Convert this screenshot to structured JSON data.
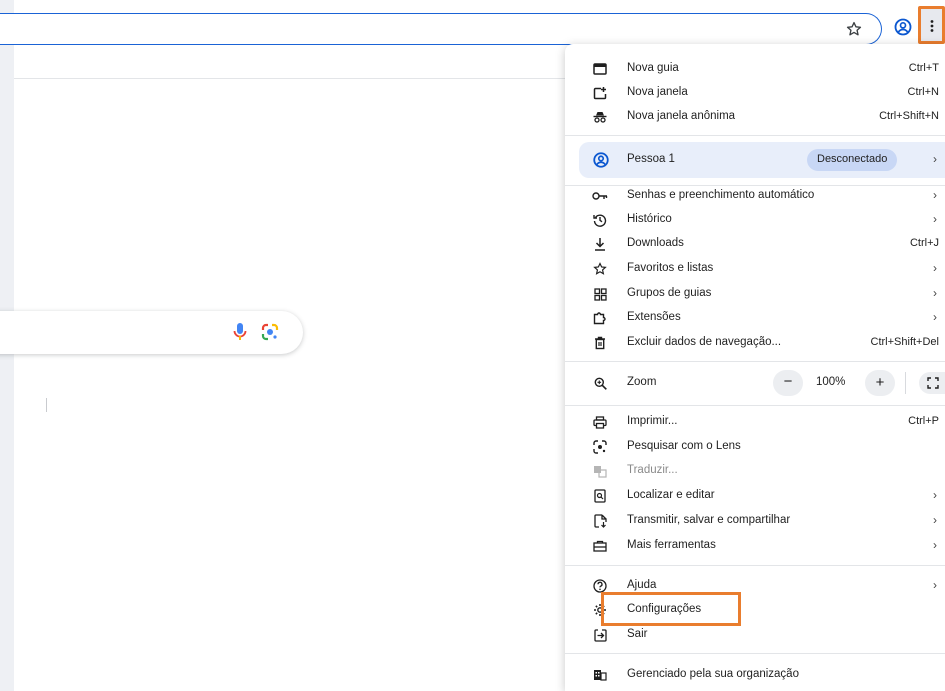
{
  "toolbar": {
    "bookmark_icon": "star-outline-icon",
    "profile_icon": "account-circle-icon",
    "menu_icon": "three-dots-vertical-icon"
  },
  "page": {
    "search_mic_icon": "microphone-icon",
    "search_lens_icon": "google-lens-icon"
  },
  "menu": {
    "group1": [
      {
        "label": "Nova guia",
        "shortcut": "Ctrl+T",
        "icon": "new-tab-icon"
      },
      {
        "label": "Nova janela",
        "shortcut": "Ctrl+N",
        "icon": "new-window-icon"
      },
      {
        "label": "Nova janela anônima",
        "shortcut": "Ctrl+Shift+N",
        "icon": "incognito-icon"
      }
    ],
    "profile": {
      "label": "Pessoa 1",
      "status": "Desconectado",
      "icon": "account-circle-icon"
    },
    "group2": [
      {
        "label": "Senhas e preenchimento automático",
        "shortcut": "",
        "icon": "key-icon",
        "submenu": true
      },
      {
        "label": "Histórico",
        "shortcut": "",
        "icon": "history-icon",
        "submenu": true
      },
      {
        "label": "Downloads",
        "shortcut": "Ctrl+J",
        "icon": "download-icon",
        "submenu": false
      },
      {
        "label": "Favoritos e listas",
        "shortcut": "",
        "icon": "star-icon",
        "submenu": true
      },
      {
        "label": "Grupos de guias",
        "shortcut": "",
        "icon": "tab-groups-icon",
        "submenu": true
      },
      {
        "label": "Extensões",
        "shortcut": "",
        "icon": "puzzle-icon",
        "submenu": true
      },
      {
        "label": "Excluir dados de navegação...",
        "shortcut": "Ctrl+Shift+Del",
        "icon": "trash-icon",
        "submenu": false
      }
    ],
    "zoom": {
      "label": "Zoom",
      "value": "100%",
      "minus": "−",
      "plus": "+",
      "icon": "zoom-icon"
    },
    "group3": [
      {
        "label": "Imprimir...",
        "shortcut": "Ctrl+P",
        "icon": "print-icon",
        "submenu": false
      },
      {
        "label": "Pesquisar com o Lens",
        "shortcut": "",
        "icon": "lens-icon",
        "submenu": false
      },
      {
        "label": "Traduzir...",
        "shortcut": "",
        "icon": "translate-icon",
        "submenu": false,
        "disabled": true
      },
      {
        "label": "Localizar e editar",
        "shortcut": "",
        "icon": "find-icon",
        "submenu": true
      },
      {
        "label": "Transmitir, salvar e compartilhar",
        "shortcut": "",
        "icon": "cast-icon",
        "submenu": true
      },
      {
        "label": "Mais ferramentas",
        "shortcut": "",
        "icon": "toolbox-icon",
        "submenu": true
      }
    ],
    "group4": [
      {
        "label": "Ajuda",
        "shortcut": "",
        "icon": "help-icon",
        "submenu": true
      },
      {
        "label": "Configurações",
        "shortcut": "",
        "icon": "settings-icon",
        "submenu": false
      },
      {
        "label": "Sair",
        "shortcut": "",
        "icon": "exit-icon",
        "submenu": false
      }
    ],
    "managed": {
      "label": "Gerenciado pela sua organização",
      "icon": "building-icon"
    },
    "chevron": "›"
  },
  "colors": {
    "accent": "#1a63d6",
    "highlight": "#e97d2e",
    "profile_bg": "#e8eefa",
    "badge_bg": "#c8d7f5"
  }
}
